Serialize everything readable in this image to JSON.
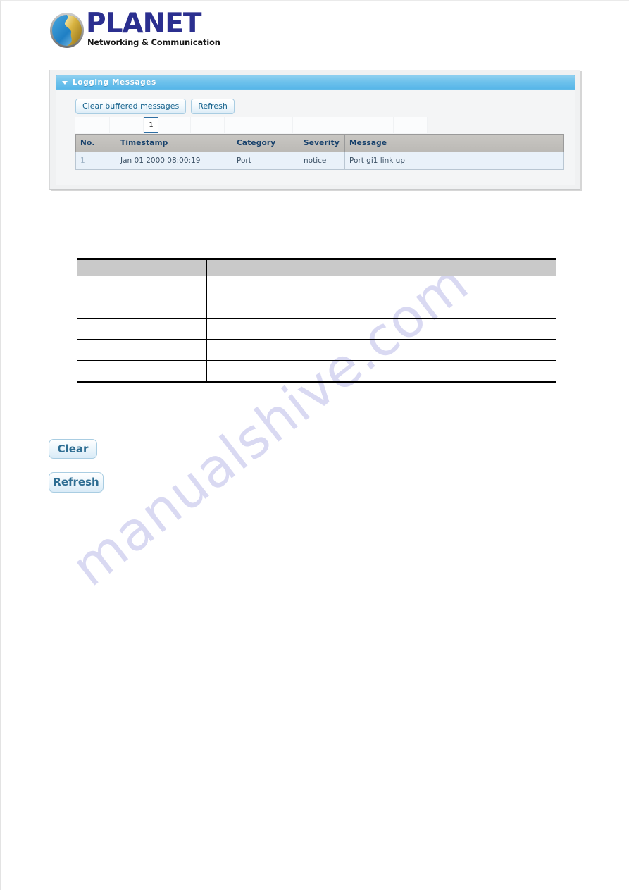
{
  "brand": {
    "name": "PLANET",
    "tagline": "Networking & Communication",
    "logo_icon": "globe-icon",
    "name_color": "#2b2f8f"
  },
  "watermark": {
    "text": "manualshive.com",
    "color": "#d3d3f0"
  },
  "panel": {
    "title": "Logging Messages",
    "collapse_icon": "caret-down-icon",
    "header_color": "#6ec2ec",
    "buttons": {
      "clear_buffered": "Clear buffered messages",
      "refresh": "Refresh"
    },
    "pagination": {
      "current_page": "1"
    },
    "table": {
      "columns": [
        "No.",
        "Timestamp",
        "Category",
        "Severity",
        "Message"
      ],
      "rows": [
        {
          "no": "1",
          "timestamp": "Jan 01 2000 08:00:19",
          "category": "Port",
          "severity": "notice",
          "message": "Port gi1 link up"
        }
      ]
    }
  },
  "doc_table": {
    "header": [
      "",
      ""
    ],
    "rows": [
      [
        "",
        ""
      ],
      [
        "",
        ""
      ],
      [
        "",
        ""
      ],
      [
        "",
        ""
      ],
      [
        "",
        ""
      ]
    ]
  },
  "doc_buttons": {
    "clear": "Clear",
    "refresh": "Refresh"
  }
}
